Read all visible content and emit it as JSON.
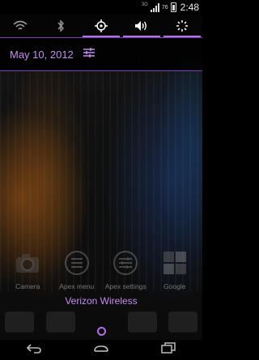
{
  "status_bar": {
    "network_type": "3G",
    "battery_percent": "76",
    "battery_level": 0.76,
    "time": "2:48"
  },
  "quick_toggles": [
    {
      "icon": "wifi-icon",
      "active": false
    },
    {
      "icon": "bluetooth-icon",
      "active": false
    },
    {
      "icon": "gps-icon",
      "active": true
    },
    {
      "icon": "sound-icon",
      "active": true
    },
    {
      "icon": "brightness-icon",
      "active": true
    }
  ],
  "notification_header": {
    "date": "May 10, 2012",
    "settings_icon": "settings-sliders-icon"
  },
  "home_apps": [
    {
      "label": "Camera",
      "icon": "camera-icon"
    },
    {
      "label": "Apex menu",
      "icon": "apex-menu-icon"
    },
    {
      "label": "Apex settings",
      "icon": "apex-settings-icon"
    },
    {
      "label": "Google",
      "icon": "google-folder-icon"
    }
  ],
  "carrier_label": "Verizon Wireless",
  "accent_color": "#b36fe6",
  "navigation": {
    "back": "back-icon",
    "home": "home-icon",
    "recents": "recent-apps-icon"
  }
}
